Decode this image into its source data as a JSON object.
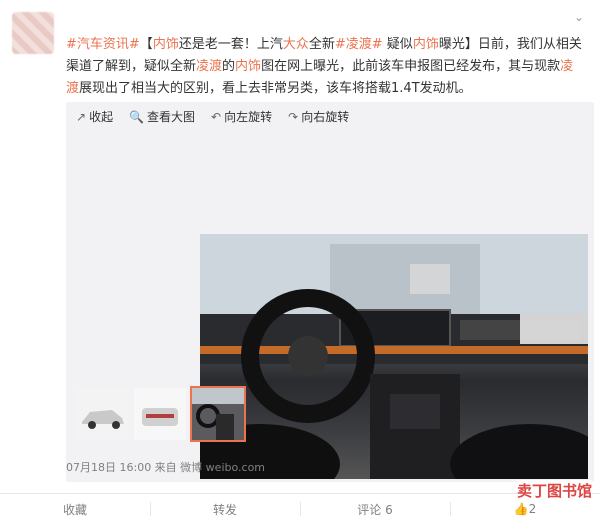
{
  "post": {
    "text_parts": [
      {
        "kind": "hash",
        "text": "#汽车资讯#"
      },
      {
        "kind": "text",
        "text": "【"
      },
      {
        "kind": "link",
        "text": "内饰"
      },
      {
        "kind": "text",
        "text": "还是老一套！上汽"
      },
      {
        "kind": "link",
        "text": "大众"
      },
      {
        "kind": "text",
        "text": "全新"
      },
      {
        "kind": "hash",
        "text": "#凌渡#"
      },
      {
        "kind": "text",
        "text": " 疑似"
      },
      {
        "kind": "link",
        "text": "内饰"
      },
      {
        "kind": "text",
        "text": "曝光】日前，我们从相关渠道了解到，疑似全新"
      },
      {
        "kind": "link",
        "text": "凌渡"
      },
      {
        "kind": "text",
        "text": "的"
      },
      {
        "kind": "link",
        "text": "内饰"
      },
      {
        "kind": "text",
        "text": "图在网上曝光，此前该车申报图已经发布，其与现款"
      },
      {
        "kind": "link",
        "text": "凌渡"
      },
      {
        "kind": "text",
        "text": "展现出了相当大的区别，看上去非常另类，该车将搭载1.4T发动机。"
      }
    ],
    "meta": "07月18日 16:00  来自 微博 weibo.com"
  },
  "toolbar": {
    "collapse": "收起",
    "view_large": "查看大图",
    "rotate_left": "向左旋转",
    "rotate_right": "向右旋转"
  },
  "actions": {
    "favorite": "收藏",
    "repost": "转发",
    "comment": "评论 6",
    "like_count": "2"
  },
  "watermark": {
    "brand": "卖丁图书馆"
  },
  "colors": {
    "accent": "#eb7350",
    "meta": "#808080",
    "toolbar_bg": "#f2f2f5"
  }
}
